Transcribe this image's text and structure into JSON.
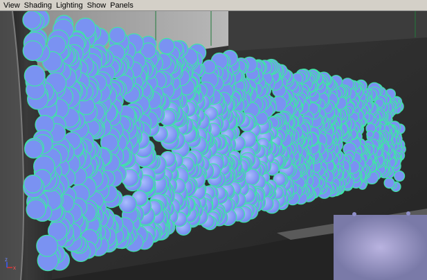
{
  "menubar": {
    "items": [
      {
        "label": "View"
      },
      {
        "label": "Shading"
      },
      {
        "label": "Lighting"
      },
      {
        "label": "Show"
      },
      {
        "label": "Panels"
      }
    ]
  },
  "viewport": {
    "description_colors": {
      "particle_fill": "#7a92f2",
      "particle_outline": "#3ee6a4",
      "background": "#2c2c2c",
      "wall": "#9a9a9a",
      "grid_line": "#1f7a3a"
    },
    "axis": {
      "x": "x",
      "z": "z"
    }
  }
}
